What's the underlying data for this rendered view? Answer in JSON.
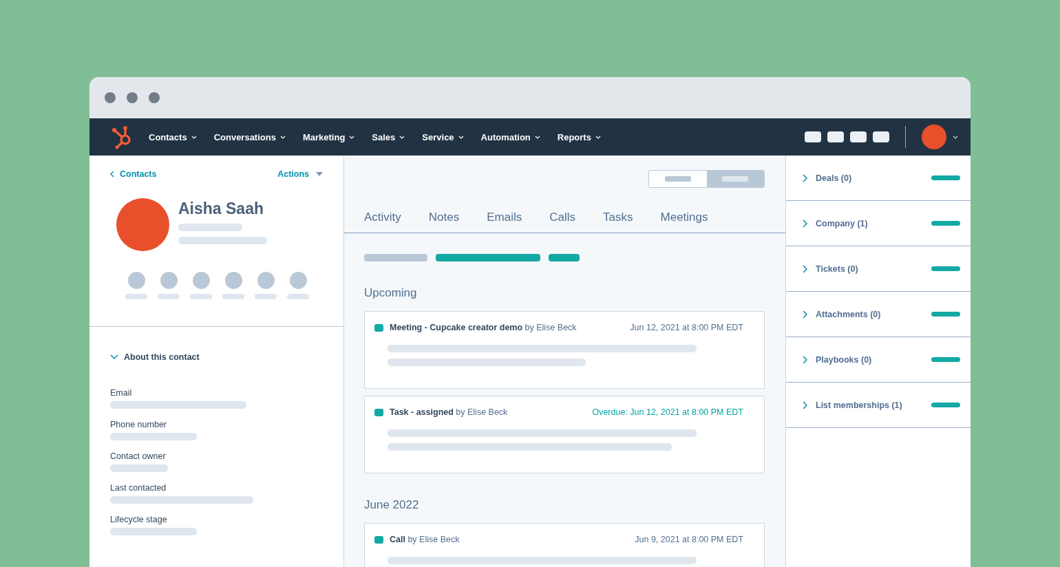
{
  "nav": {
    "items": [
      {
        "label": "Contacts"
      },
      {
        "label": "Conversations"
      },
      {
        "label": "Marketing"
      },
      {
        "label": "Sales"
      },
      {
        "label": "Service"
      },
      {
        "label": "Automation"
      },
      {
        "label": "Reports"
      }
    ]
  },
  "contact": {
    "back_link": "Contacts",
    "actions": "Actions",
    "name": "Aisha Saah"
  },
  "about": {
    "title": "About this contact",
    "expanded": true,
    "fields": [
      {
        "label": "Email"
      },
      {
        "label": "Phone number"
      },
      {
        "label": "Contact owner"
      },
      {
        "label": "Last contacted"
      },
      {
        "label": "Lifecycle stage"
      }
    ]
  },
  "tabs": [
    {
      "label": "Activity"
    },
    {
      "label": "Notes"
    },
    {
      "label": "Emails"
    },
    {
      "label": "Calls"
    },
    {
      "label": "Tasks"
    },
    {
      "label": "Meetings"
    }
  ],
  "timeline": [
    {
      "heading": "Upcoming",
      "entries": [
        {
          "title": "Meeting - Cupcake creator demo",
          "by": "by Elise Beck",
          "date": "Jun 12, 2021 at 8:00 PM EDT",
          "overdue": false
        },
        {
          "title": "Task - assigned",
          "by": "by Elise Beck",
          "date": "Overdue: Jun 12, 2021 at 8:00 PM EDT",
          "overdue": true
        }
      ]
    },
    {
      "heading": "June 2022",
      "entries": [
        {
          "title": "Call",
          "by": "by Elise Beck",
          "date": "Jun 9, 2021 at 8:00 PM EDT",
          "overdue": false
        }
      ]
    }
  ],
  "sidebar": {
    "items": [
      {
        "label": "Deals (0)",
        "expanded": false
      },
      {
        "label": "Company (1)",
        "expanded": false
      },
      {
        "label": "Tickets (0)",
        "expanded": false
      },
      {
        "label": "Attachments (0)",
        "expanded": false
      },
      {
        "label": "Playbooks (0)",
        "expanded": false
      },
      {
        "label": "List memberships (1)",
        "expanded": false
      }
    ]
  }
}
